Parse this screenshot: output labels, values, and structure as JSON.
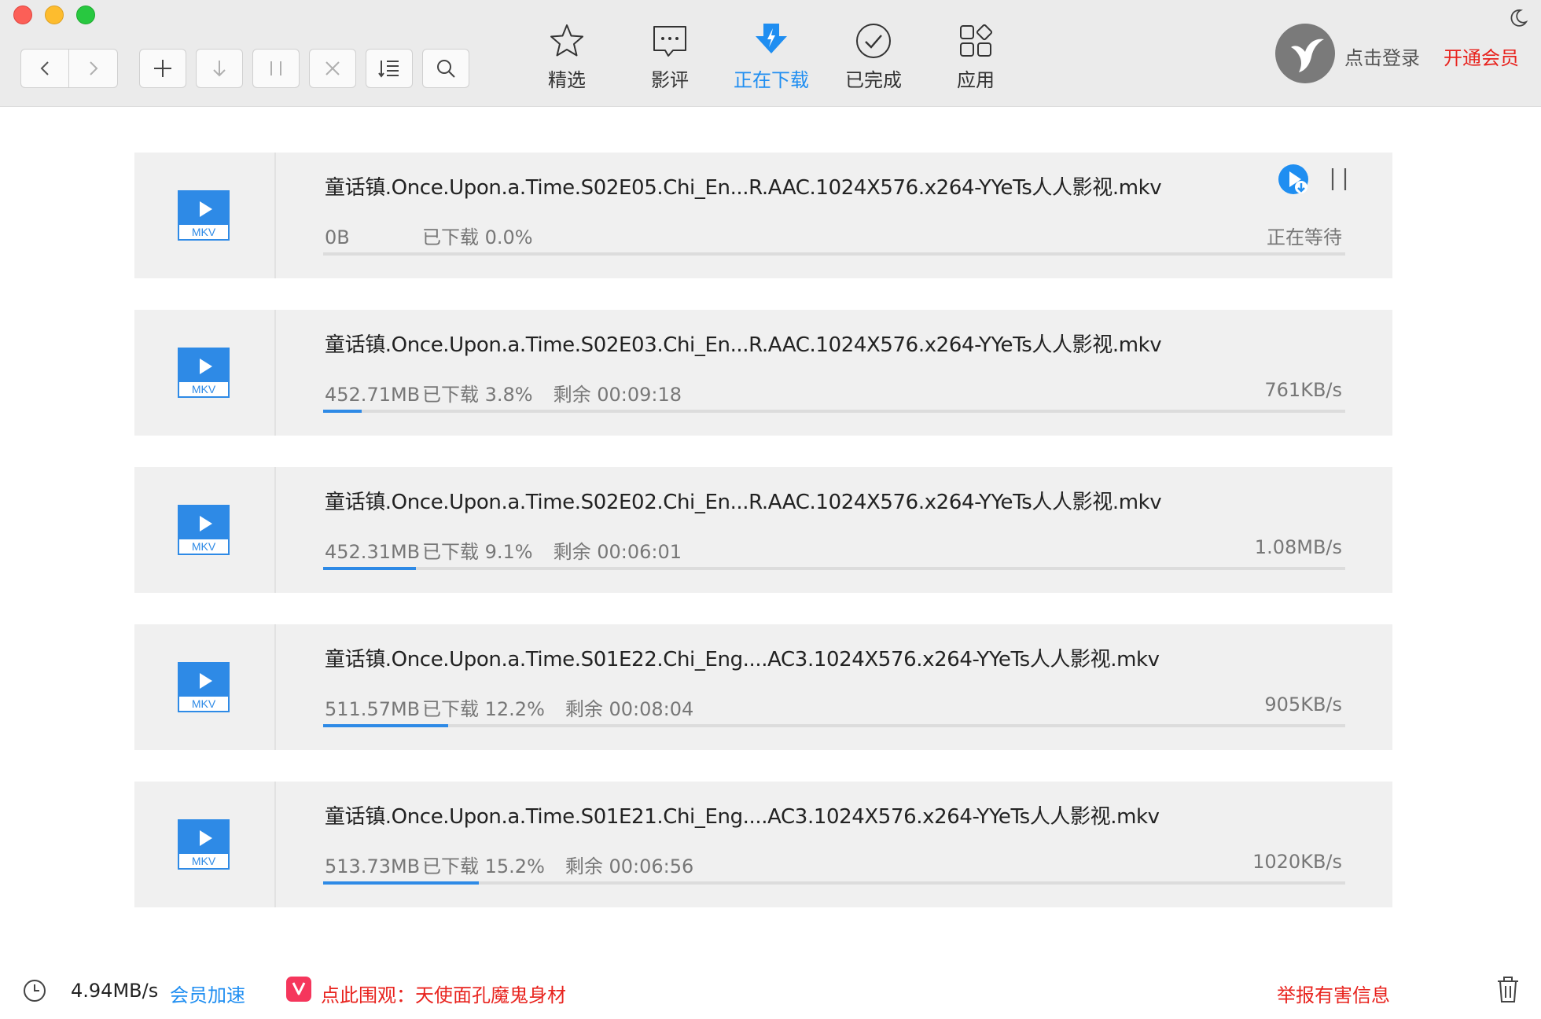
{
  "toolbar": {
    "buttons": [
      {
        "icon": "back-icon"
      },
      {
        "icon": "forward-icon"
      },
      {
        "icon": "add-icon"
      },
      {
        "icon": "start-all-icon"
      },
      {
        "icon": "pause-all-icon"
      },
      {
        "icon": "delete-icon"
      },
      {
        "icon": "sort-icon"
      },
      {
        "icon": "search-icon"
      }
    ]
  },
  "nav": {
    "tabs": [
      {
        "label": "精选",
        "icon": "star-icon"
      },
      {
        "label": "影评",
        "icon": "comment-icon"
      },
      {
        "label": "正在下载",
        "icon": "downloading-icon",
        "active": true
      },
      {
        "label": "已完成",
        "icon": "check-circle-icon"
      },
      {
        "label": "应用",
        "icon": "apps-icon"
      }
    ],
    "active_color": "#1f8ef1"
  },
  "account": {
    "login_label": "点击登录",
    "vip_label": "开通会员"
  },
  "tasks": [
    {
      "filename": "童话镇.Once.Upon.a.Time.S02E05.Chi_En...R.AAC.1024X576.x264-YYeTs人人影视.mkv",
      "type": "MKV",
      "size": "0B",
      "progress_text": "已下载 0.0%",
      "remaining": "",
      "status": "正在等待",
      "progress": 0.0
    },
    {
      "filename": "童话镇.Once.Upon.a.Time.S02E03.Chi_En...R.AAC.1024X576.x264-YYeTs人人影视.mkv",
      "type": "MKV",
      "size": "452.71MB",
      "progress_text": "已下载 3.8%",
      "remaining": "剩余 00:09:18",
      "status": "761KB/s",
      "progress": 3.8
    },
    {
      "filename": "童话镇.Once.Upon.a.Time.S02E02.Chi_En...R.AAC.1024X576.x264-YYeTs人人影视.mkv",
      "type": "MKV",
      "size": "452.31MB",
      "progress_text": "已下载 9.1%",
      "remaining": "剩余 00:06:01",
      "status": "1.08MB/s",
      "progress": 9.1
    },
    {
      "filename": "童话镇.Once.Upon.a.Time.S01E22.Chi_Eng....AC3.1024X576.x264-YYeTs人人影视.mkv",
      "type": "MKV",
      "size": "511.57MB",
      "progress_text": "已下载 12.2%",
      "remaining": "剩余 00:08:04",
      "status": "905KB/s",
      "progress": 12.2
    },
    {
      "filename": "童话镇.Once.Upon.a.Time.S01E21.Chi_Eng....AC3.1024X576.x264-YYeTs人人影视.mkv",
      "type": "MKV",
      "size": "513.73MB",
      "progress_text": "已下载 15.2%",
      "remaining": "剩余 00:06:56",
      "status": "1020KB/s",
      "progress": 15.2
    }
  ],
  "statusbar": {
    "speed": "4.94MB/s",
    "boost_label": "会员加速",
    "promo_label": "点此围观：天使面孔魔鬼身材",
    "report_label": "举报有害信息"
  }
}
